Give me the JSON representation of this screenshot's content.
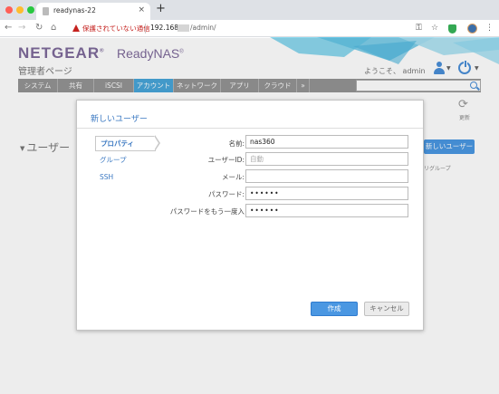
{
  "browser": {
    "tab_title": "readynas-22",
    "tab_close": "×",
    "new_tab": "+",
    "security_text": "保護されていない通信",
    "url_host": "192.168.",
    "url_path": "/admin/",
    "icons": [
      "back-icon",
      "forward-icon",
      "reload-icon",
      "home-icon",
      "warning-icon",
      "key-icon",
      "star-icon",
      "shield-extension-icon",
      "profile-icon",
      "menu-icon"
    ]
  },
  "header": {
    "logo": "NETGEAR",
    "logo_mark": "®",
    "product": "ReadyNAS",
    "product_mark": "®",
    "admin_page": "管理者ページ",
    "welcome": "ようこそ、 admin"
  },
  "nav": {
    "tabs": [
      "システム",
      "共有",
      "iSCSI",
      "アカウント",
      "ネットワーク",
      "アプリ",
      "クラウド",
      "»"
    ],
    "active": "アカウント"
  },
  "toolbar": {
    "refresh_label": "更新"
  },
  "background": {
    "section_title": "ユーザー",
    "new_user_button": "新しいユーザー",
    "column_partial": "リグループ"
  },
  "dialog": {
    "title": "新しいユーザー",
    "sidebar": [
      "プロパティ",
      "グループ",
      "SSH"
    ],
    "fields": {
      "name": {
        "label": "名前:",
        "value": "nas360"
      },
      "user_id": {
        "label": "ユーザーID:",
        "placeholder": "自動"
      },
      "email": {
        "label": "メール:",
        "value": ""
      },
      "password": {
        "label": "パスワード:",
        "value": "••••••"
      },
      "password_confirm": {
        "label": "パスワードをもう一度入",
        "value": "••••••"
      }
    },
    "create_button": "作成",
    "cancel_button": "キャンセル"
  },
  "colors": {
    "accent_blue": "#4a97e2",
    "brand_purple": "#7e6a9a",
    "nav_gray": "#949494",
    "nav_active": "#48a5d9"
  }
}
